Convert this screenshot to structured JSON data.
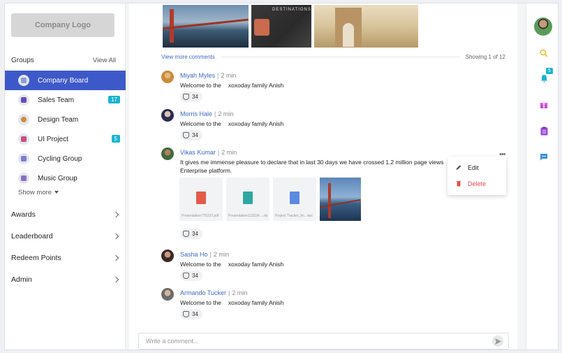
{
  "sidebar": {
    "logo": "Company Logo",
    "groups_title": "Groups",
    "view_all": "View All",
    "groups": [
      {
        "label": "Company Board",
        "active": true,
        "count": "",
        "color": "#8a9fd0"
      },
      {
        "label": "Sales Team",
        "active": false,
        "count": "17",
        "color": "#6a4bb8"
      },
      {
        "label": "Design Team",
        "active": false,
        "count": "",
        "color": "#d28a3a"
      },
      {
        "label": "UI Project",
        "active": false,
        "count": "5",
        "color": "#c94f7c"
      },
      {
        "label": "Cycling Group",
        "active": false,
        "count": "",
        "color": "#7b7bd0"
      },
      {
        "label": "Music Group",
        "active": false,
        "count": "",
        "color": "#8a6fc0"
      }
    ],
    "show_more": "Show more",
    "nav": [
      "Awards",
      "Leaderboard",
      "Redeem Points",
      "Admin"
    ]
  },
  "feed": {
    "top_image_caption": "DESTINATIONS",
    "view_more": "View more comments",
    "showing": "Showing 1 of 12",
    "comments": [
      {
        "name": "Miyah Myles",
        "time": "2 min",
        "text_a": "Welcome to the",
        "text_b": "xoxoday family Anish",
        "likes": "34"
      },
      {
        "name": "Morris Hale",
        "time": "2 min",
        "text_a": "Welcome to the",
        "text_b": "xoxoday family Anish",
        "likes": "34"
      },
      {
        "name": "Vikas Kumar",
        "time": "2 min",
        "text": "It gives me immense pleasure to declare that in last 30 days we have crossed 1.2 million page views Enterprise platform.",
        "likes": "34"
      },
      {
        "name": "Sasha Ho",
        "time": "2 min",
        "text_a": "Welcome to the",
        "text_b": "xoxoday family Anish",
        "likes": "34"
      },
      {
        "name": "Armando Tucker",
        "time": "2 min",
        "text_a": "Welcome to the",
        "text_b": "xoxoday family Anish",
        "likes": "34"
      }
    ],
    "attachments": [
      {
        "name": "Presentation7T5237.pdf",
        "icon": "pdf-icon",
        "color": "#e25b4a"
      },
      {
        "name": "Presentation123234....xlsx",
        "icon": "sheet-icon",
        "color": "#2fa9a0"
      },
      {
        "name": "Project Tracker_fin...doc",
        "icon": "doc-icon",
        "color": "#5b8ae2"
      }
    ],
    "menu": {
      "edit": "Edit",
      "delete": "Delete"
    },
    "write_placeholder": "Write a comment..."
  },
  "rail": {
    "notification_count": "5",
    "icons": [
      "search-icon",
      "bell-icon",
      "gift-icon",
      "clipboard-icon",
      "chat-icon"
    ],
    "colors": {
      "search": "#f2b21b",
      "bell": "#19b5d0",
      "gift": "#c84ad8",
      "clipboard": "#9b4ad8",
      "chat": "#3d8fe0"
    }
  },
  "colors": {
    "accent": "#3d59c9",
    "link": "#3d6ac4",
    "badge": "#19b5d0",
    "danger": "#e04b4b"
  }
}
